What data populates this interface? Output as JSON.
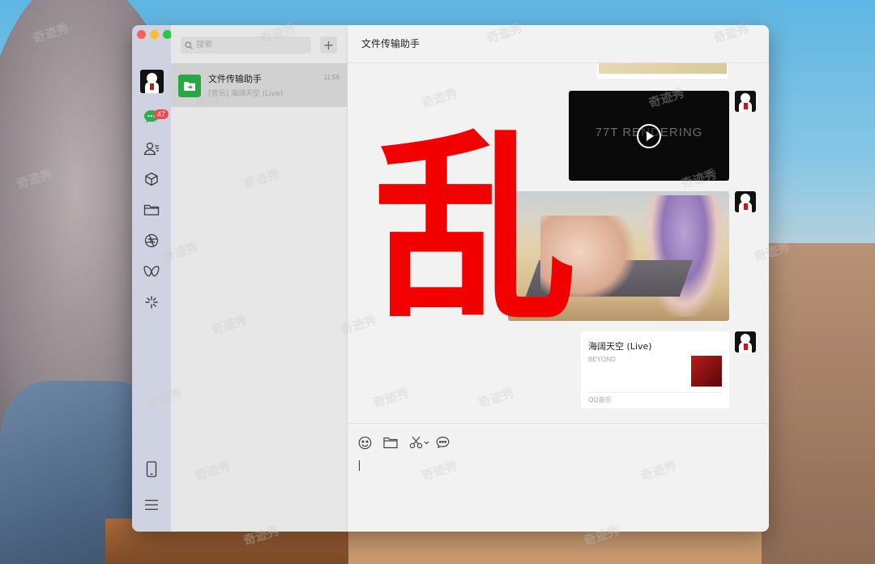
{
  "window": {
    "title": "文件传输助手"
  },
  "sidebar": {
    "unread_badge": "47"
  },
  "search": {
    "placeholder": "搜索"
  },
  "add_button": {
    "label": "+"
  },
  "chats": [
    {
      "title": "文件传输助手",
      "time": "11:56",
      "preview": "[音乐] 海阔天空 (Live)"
    }
  ],
  "messages": {
    "video": {
      "text": "77T RENDERING"
    },
    "music": {
      "title": "海阔天空 (Live)",
      "artist": "BEYOND",
      "source": "QQ音乐"
    }
  },
  "overlay": {
    "text": "乱"
  },
  "watermark": {
    "text": "奇迹秀"
  },
  "colors": {
    "accent_green": "#2aa745",
    "badge_red": "#f24a4a",
    "overlay_red": "#f20000"
  },
  "icons": [
    "chat-icon",
    "contacts-icon",
    "cube-icon",
    "folder-icon",
    "aperture-icon",
    "butterfly-icon",
    "spark-icon",
    "phone-icon",
    "menu-icon",
    "emoji-icon",
    "file-icon",
    "scissors-icon",
    "bubble-icon"
  ]
}
